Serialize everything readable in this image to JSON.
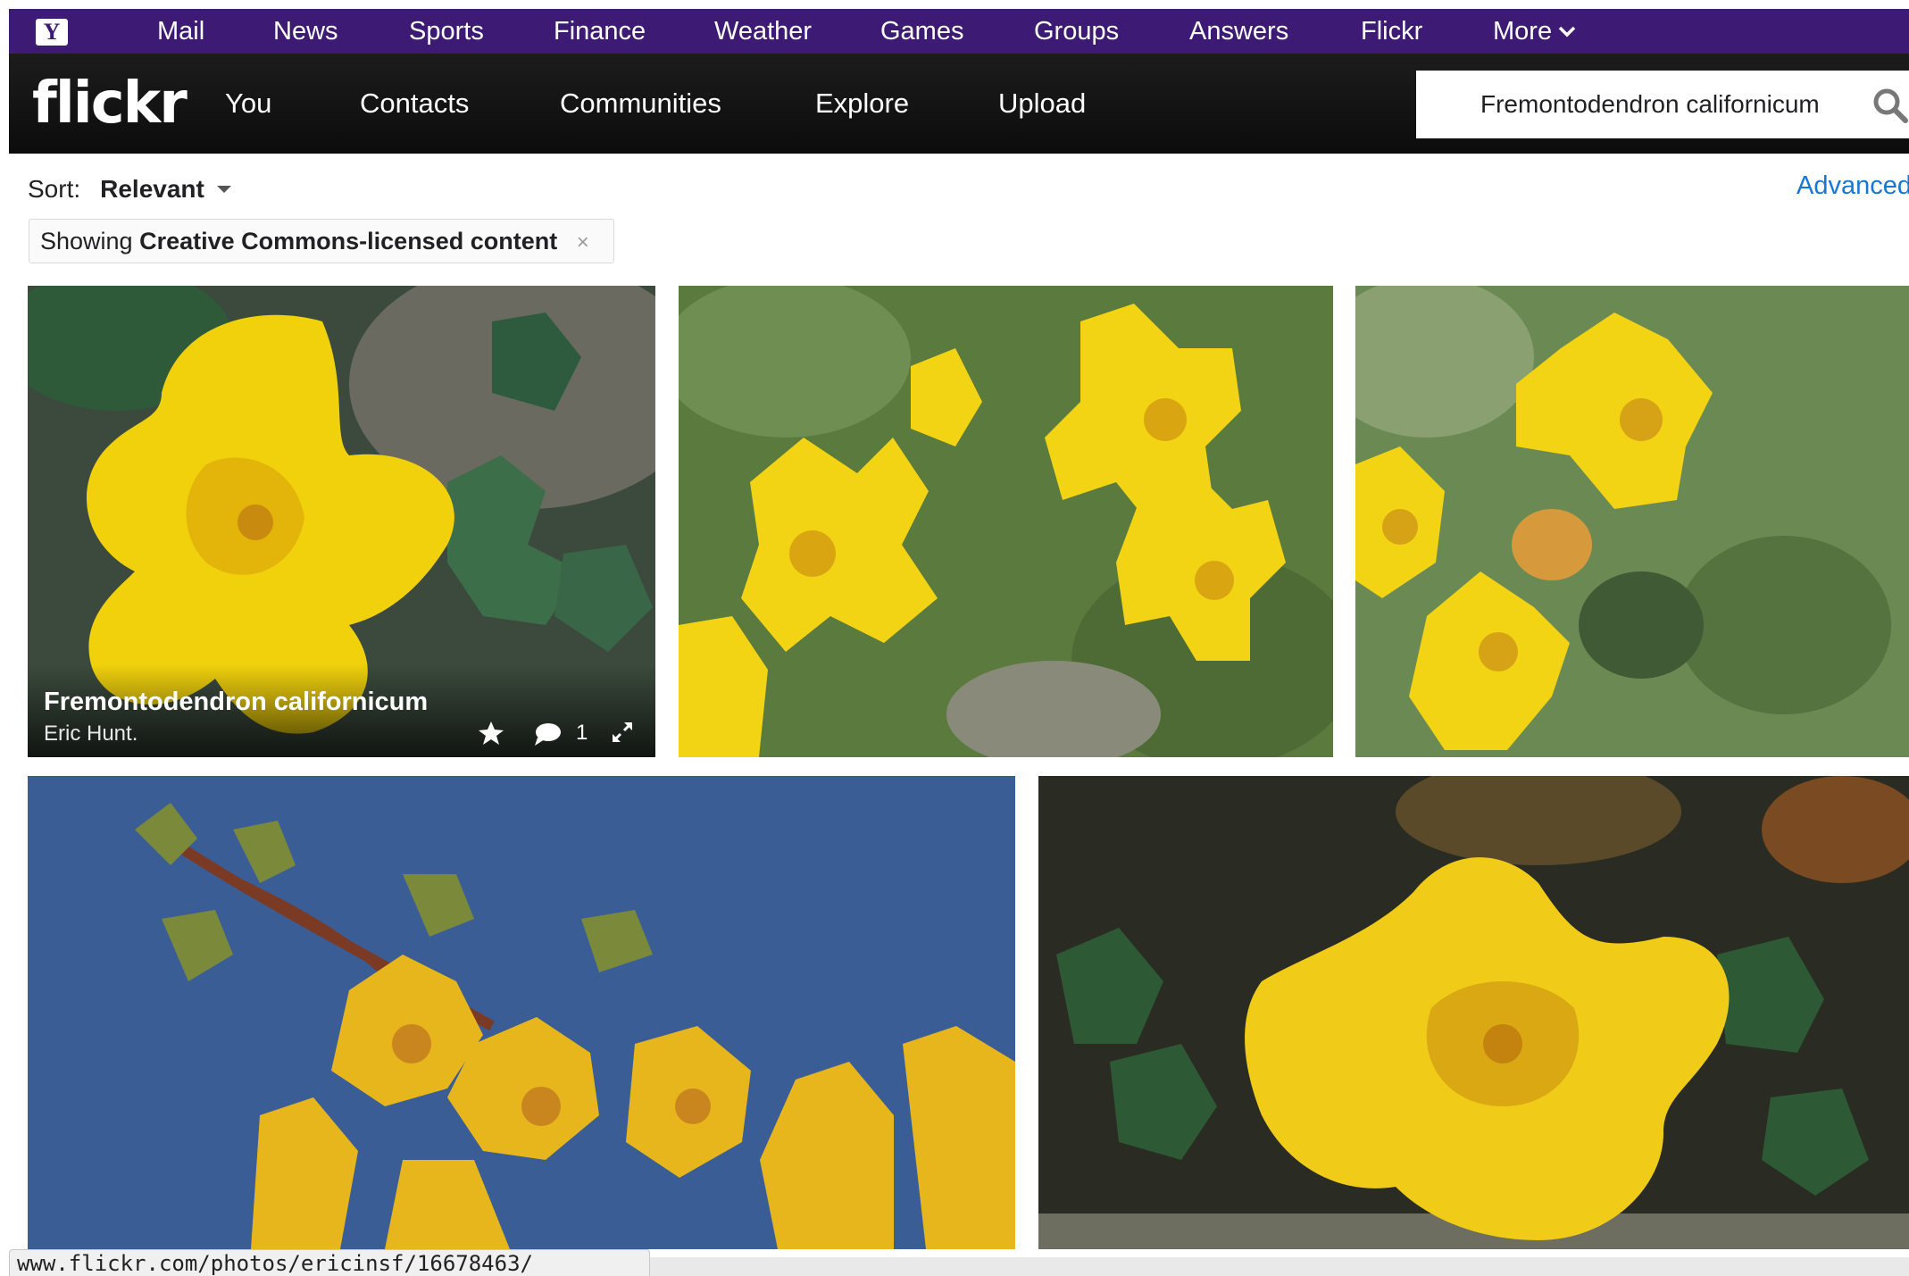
{
  "yahoo_bar": {
    "logo": "Y",
    "links": [
      "Mail",
      "News",
      "Sports",
      "Finance",
      "Weather",
      "Games",
      "Groups",
      "Answers",
      "Flickr"
    ],
    "more_label": "More"
  },
  "flickr_bar": {
    "logo": "flickr",
    "nav": [
      "You",
      "Contacts",
      "Communities",
      "Explore",
      "Upload"
    ],
    "search_value": "Fremontodendron californicum"
  },
  "sort": {
    "label": "Sort:",
    "value": "Relevant",
    "advanced_label": "Advanced"
  },
  "filter": {
    "prefix": "Showing",
    "value": "Creative Commons-licensed content",
    "close": "×"
  },
  "photos": [
    {
      "title": "Fremontodendron californicum",
      "author": "Eric Hunt.",
      "comments": "1"
    }
  ],
  "statusbar": {
    "url": "www.flickr.com/photos/ericinsf/16678463/"
  },
  "colors": {
    "yahoo_purple": "#3d1a74",
    "flickr_black": "#111111",
    "link_blue": "#1577d6",
    "flower_yellow": "#f2d20a"
  }
}
